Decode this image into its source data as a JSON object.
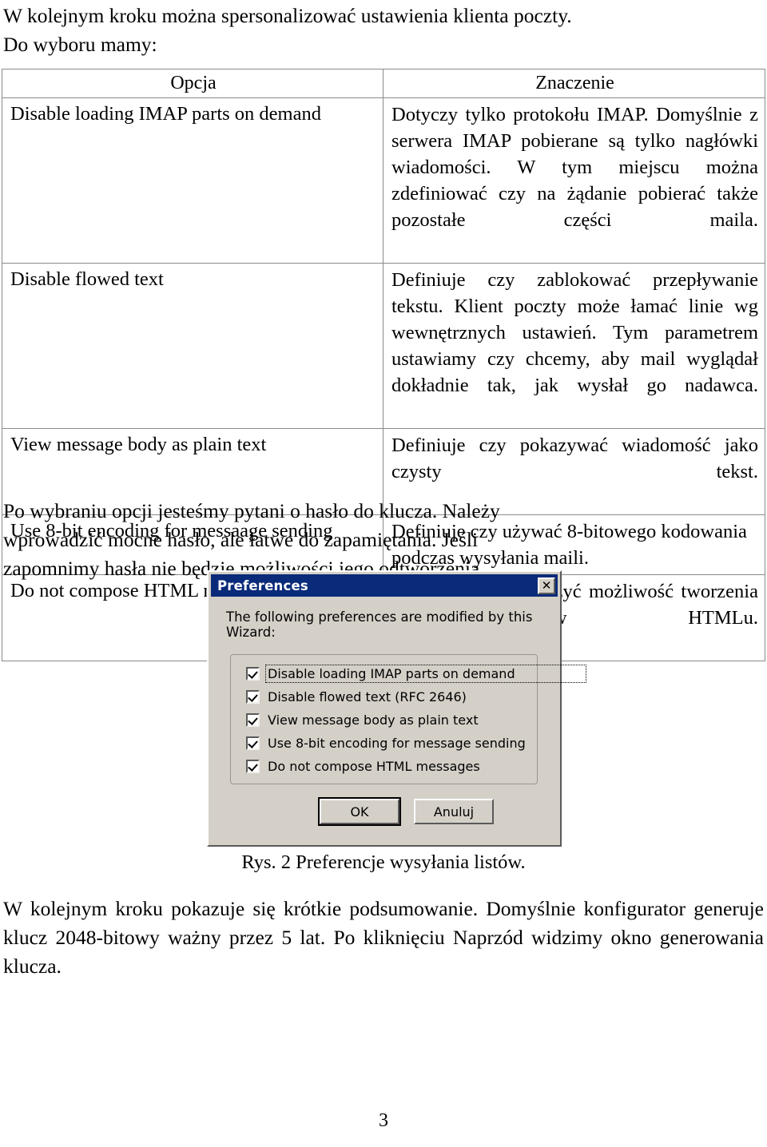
{
  "document": {
    "page_number": "3",
    "intro_lines": [
      "W kolejnym kroku można spersonalizować ustawienia klienta poczty.",
      "Do wyboru mamy:"
    ],
    "paragraph_after_table": "Po wybraniu opcji jesteśmy pytani o hasło do klucza. Należy wprowadzić mocne hasło, ale łatwe do zapamiętania. Jeśli zapomnimy hasła nie będzie możliwości jego odtworzenia.",
    "figure_caption": "Rys. 2   Preferencje wysyłania listów.",
    "paragraph_bottom": "W kolejnym kroku pokazuje się krótkie podsumowanie. Domyślnie konfigurator generuje klucz 2048-bitowy ważny przez 5 lat. Po kliknięciu Naprzód widzimy okno generowania klucza."
  },
  "options_table": {
    "headers": [
      "Opcja",
      "Znaczenie"
    ],
    "rows": [
      {
        "option": "Disable loading IMAP parts on demand",
        "meaning": "Dotyczy tylko protokołu IMAP. Domyślnie z serwera IMAP pobierane są tylko nagłówki wiadomości. W tym miejscu można zdefiniować czy na żądanie pobierać także pozostałe części maila."
      },
      {
        "option": "Disable flowed text",
        "meaning": "Definiuje czy zablokować przepływanie tekstu. Klient poczty może łamać linie wg wewnętrznych ustawień. Tym parametrem ustawiamy czy chcemy, aby mail wyglądał dokładnie tak, jak wysłał go nadawca."
      },
      {
        "option": "View message body as plain text",
        "meaning": "Definiuje czy pokazywać wiadomość jako czysty tekst."
      },
      {
        "option": "Use 8-bit encoding for messaage sending",
        "meaning": "Definiuje czy używać 8-bitowego kodowania podczas wysyłania maili."
      },
      {
        "option": "Do not compose HTML message",
        "meaning": "Definiuje czy wyłączyć możliwość tworzenia maili w HTMLu."
      }
    ]
  },
  "preferences_dialog": {
    "title": "Preferences",
    "close_icon": "close-icon",
    "message": "The following preferences are modified by this Wizard:",
    "checkboxes": [
      {
        "label": "Disable loading IMAP parts on demand",
        "checked": true,
        "focused": true
      },
      {
        "label": "Disable flowed text (RFC 2646)",
        "checked": true,
        "focused": false
      },
      {
        "label": "View message body as plain text",
        "checked": true,
        "focused": false
      },
      {
        "label": "Use 8-bit encoding for message sending",
        "checked": true,
        "focused": false
      },
      {
        "label": "Do not compose HTML messages",
        "checked": true,
        "focused": false
      }
    ],
    "buttons": {
      "ok": "OK",
      "cancel": "Anuluj"
    },
    "colors": {
      "titlebar": "#0a2a7a",
      "face": "#d4d0c8",
      "title_text": "#ffffff"
    }
  }
}
